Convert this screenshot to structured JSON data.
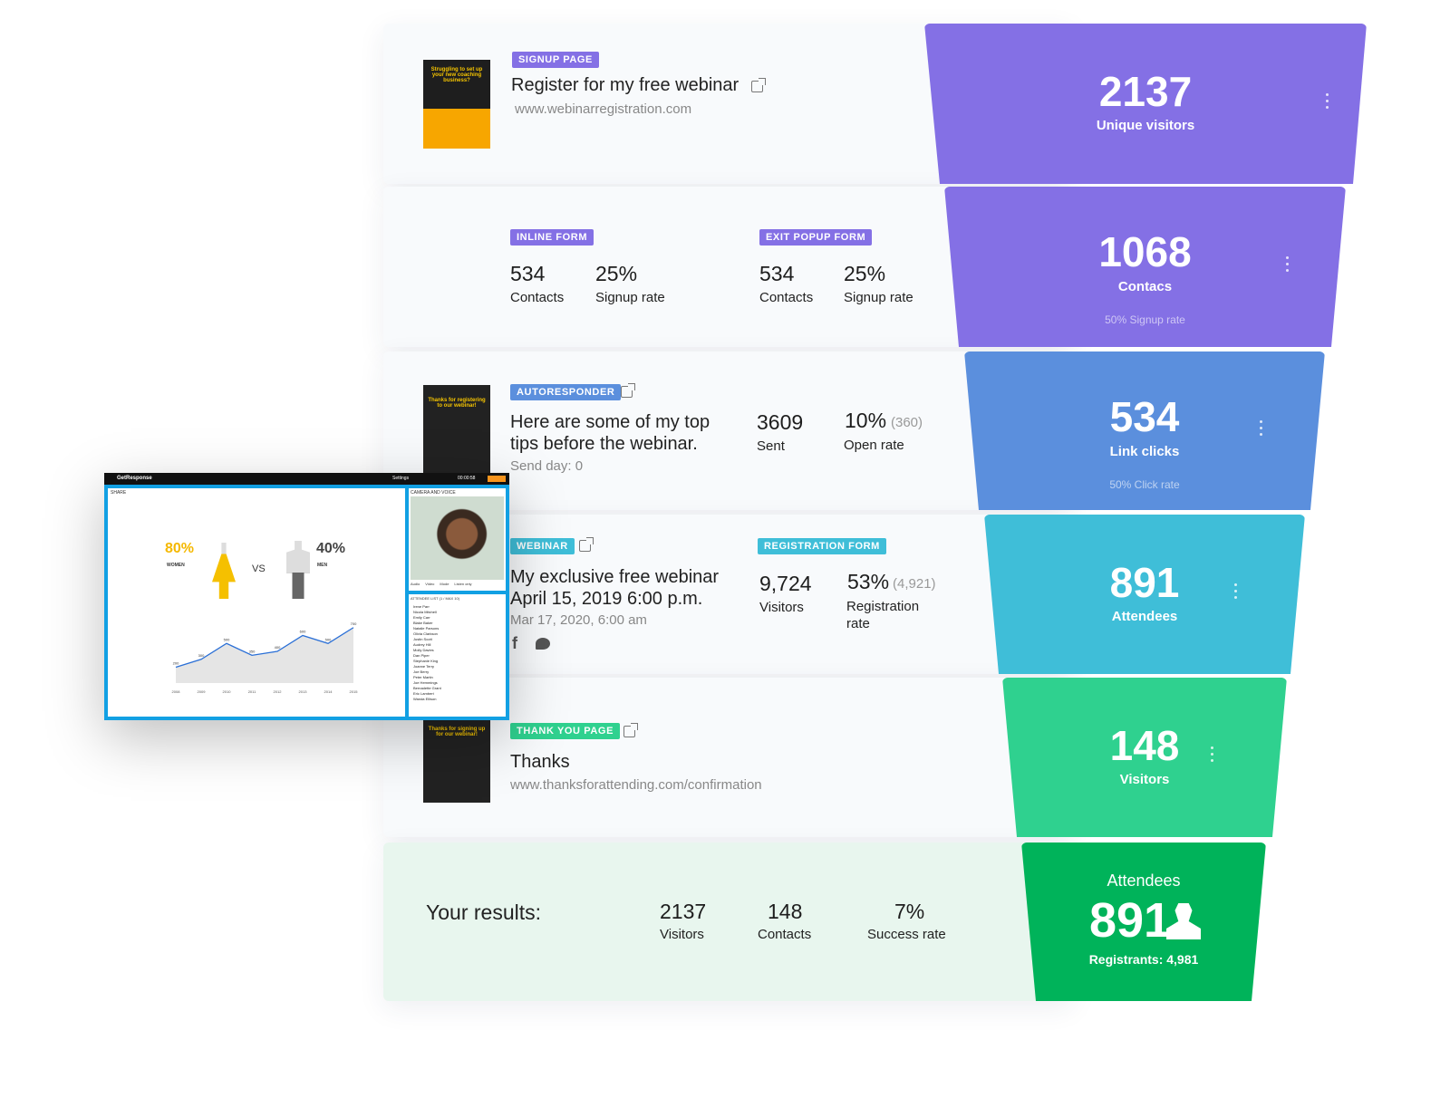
{
  "steps": [
    {
      "tag": "SIGNUP PAGE",
      "tag_color": "#8470e5",
      "title": "Register for my free webinar",
      "url": "www.webinarregistration.com",
      "thumb_text": "Struggling to set up your new coaching business?"
    },
    {
      "forms": [
        {
          "tag": "INLINE FORM",
          "contacts": "534",
          "contacts_label": "Contacts",
          "rate": "25%",
          "rate_label": "Signup rate"
        },
        {
          "tag": "EXIT POPUP FORM",
          "contacts": "534",
          "contacts_label": "Contacts",
          "rate": "25%",
          "rate_label": "Signup rate"
        }
      ],
      "tag_color": "#8470e5"
    },
    {
      "tag": "AUTORESPONDER",
      "tag_color": "#5b8fdd",
      "title_line1": "Here are some of my top",
      "title_line2": "tips before the webinar.",
      "send_day": "Send day: 0",
      "sent": "3609",
      "sent_label": "Sent",
      "open_rate": "10%",
      "open_count": "(360)",
      "open_label": "Open rate",
      "thumb_text": "Thanks for registering to our webinar!"
    },
    {
      "tag": "WEBINAR",
      "tag_color": "#3fbed8",
      "title_line1": "My exclusive free webinar",
      "title_line2": "April 15, 2019 6:00 p.m.",
      "date": "Mar 17, 2020, 6:00 am",
      "form_tag": "REGISTRATION FORM",
      "visitors": "9,724",
      "visitors_label": "Visitors",
      "reg_rate": "53%",
      "reg_count": "(4,921)",
      "reg_label_1": "Registration",
      "reg_label_2": "rate",
      "social": [
        "facebook-icon",
        "twitter-icon"
      ]
    },
    {
      "tag": "THANK YOU PAGE",
      "tag_color": "#2fd18f",
      "title": "Thanks",
      "url": "www.thanksforattending.com/confirmation",
      "thumb_text": "Thanks for signing up for our webinar!"
    }
  ],
  "results": {
    "label": "Your results:",
    "visitors": "2137",
    "visitors_label": "Visitors",
    "contacts": "148",
    "contacts_label": "Contacts",
    "success": "7%",
    "success_label": "Success rate"
  },
  "funnel": [
    {
      "value": "2137",
      "label": "Unique visitors",
      "color": "#8470e5"
    },
    {
      "value": "1068",
      "label": "Contacs",
      "rate": "50% Signup rate",
      "color": "#8470e5"
    },
    {
      "value": "534",
      "label": "Link clicks",
      "rate": "50% Click rate",
      "color": "#5b8fdd"
    },
    {
      "value": "891",
      "label": "Attendees",
      "color": "#3fbed8"
    },
    {
      "value": "148",
      "label": "Visitors",
      "color": "#2fd18f"
    },
    {
      "value": "891",
      "label": "Attendees",
      "sub": "Registrants: 4,981",
      "color": "#00b35a"
    }
  ],
  "webinar_room": {
    "brand": "GetResponse",
    "settings": "Settings",
    "timer": "00:00:58",
    "share": "SHARE",
    "camera": "CAMERA AND VOICE",
    "women_pct": "80%",
    "women": "WOMEN",
    "vs": "VS",
    "men_pct": "40%",
    "men": "MEN",
    "controls": [
      "Audio",
      "Video",
      "Mode",
      "Listen only"
    ],
    "attendee_title": "ATTENDEE LIST (1 / MAX 10)",
    "attendees": [
      "Irene Parr",
      "Nicola Mitchell",
      "Emily Carr",
      "Blake Baker",
      "Natalie Parsons",
      "Olivia Clarkson",
      "Justin Scott",
      "Audrey Hill",
      "Molly Davies",
      "Dan Piper",
      "Stephanie King",
      "Joanne Terry",
      "Joe Berry",
      "Peter Martin",
      "Joe Hemmings",
      "Bernadette Grant",
      "Eric Lambert",
      "Wanda Ellison"
    ],
    "chart_years": [
      "2008",
      "2009",
      "2010",
      "2011",
      "2012",
      "2013",
      "2014",
      "2015"
    ],
    "chart_values": [
      200,
      300,
      500,
      350,
      400,
      600,
      500,
      700
    ]
  }
}
